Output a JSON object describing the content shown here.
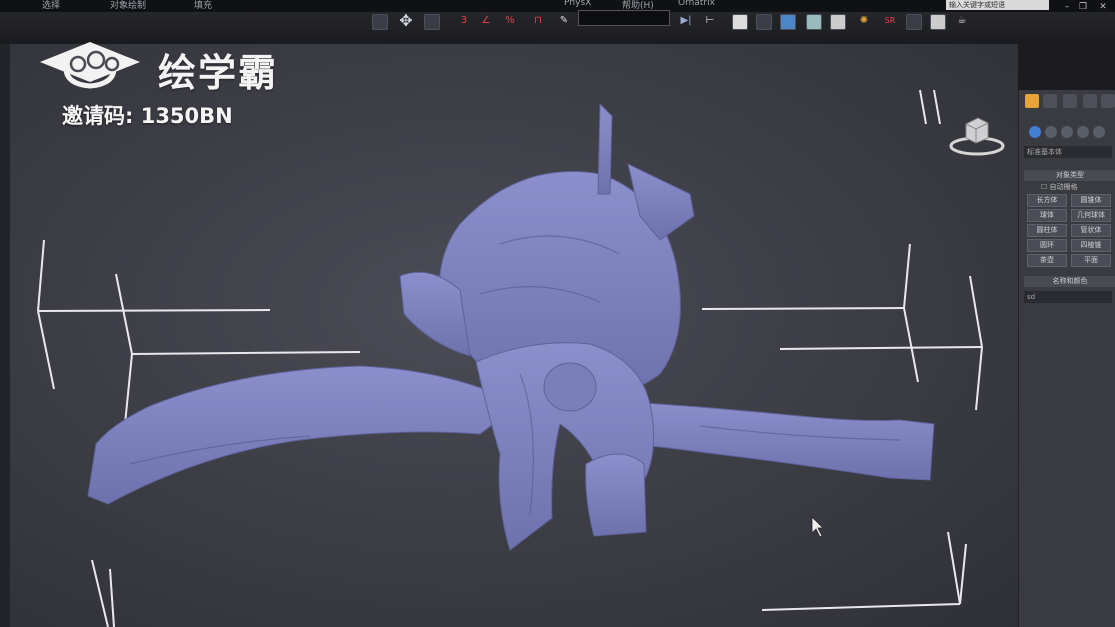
{
  "watermark": {
    "brand": "绘学霸",
    "invite_code": "邀请码: 1350BN"
  },
  "menu": {
    "items": [
      "选择",
      "对象绘制",
      "填充",
      "PhysX",
      "帮助(H)",
      "Ornatrix"
    ]
  },
  "search": {
    "placeholder": "输入关键字或短语"
  },
  "command_panel": {
    "dropdown": "标准基本体",
    "object_type_label": "对象类型",
    "autogrid_label": "自动栅格",
    "object_buttons": [
      "长方体",
      "圆锥体",
      "球体",
      "几何球体",
      "圆柱体",
      "管状体",
      "圆环",
      "四棱锥",
      "茶壶",
      "平面"
    ],
    "name_color_label": "名称和颜色",
    "name_value": "sd"
  },
  "colors": {
    "viewport_bg": "#43434c",
    "mesh": "#7f84c0",
    "watermark_text": "#f4f4f4"
  }
}
